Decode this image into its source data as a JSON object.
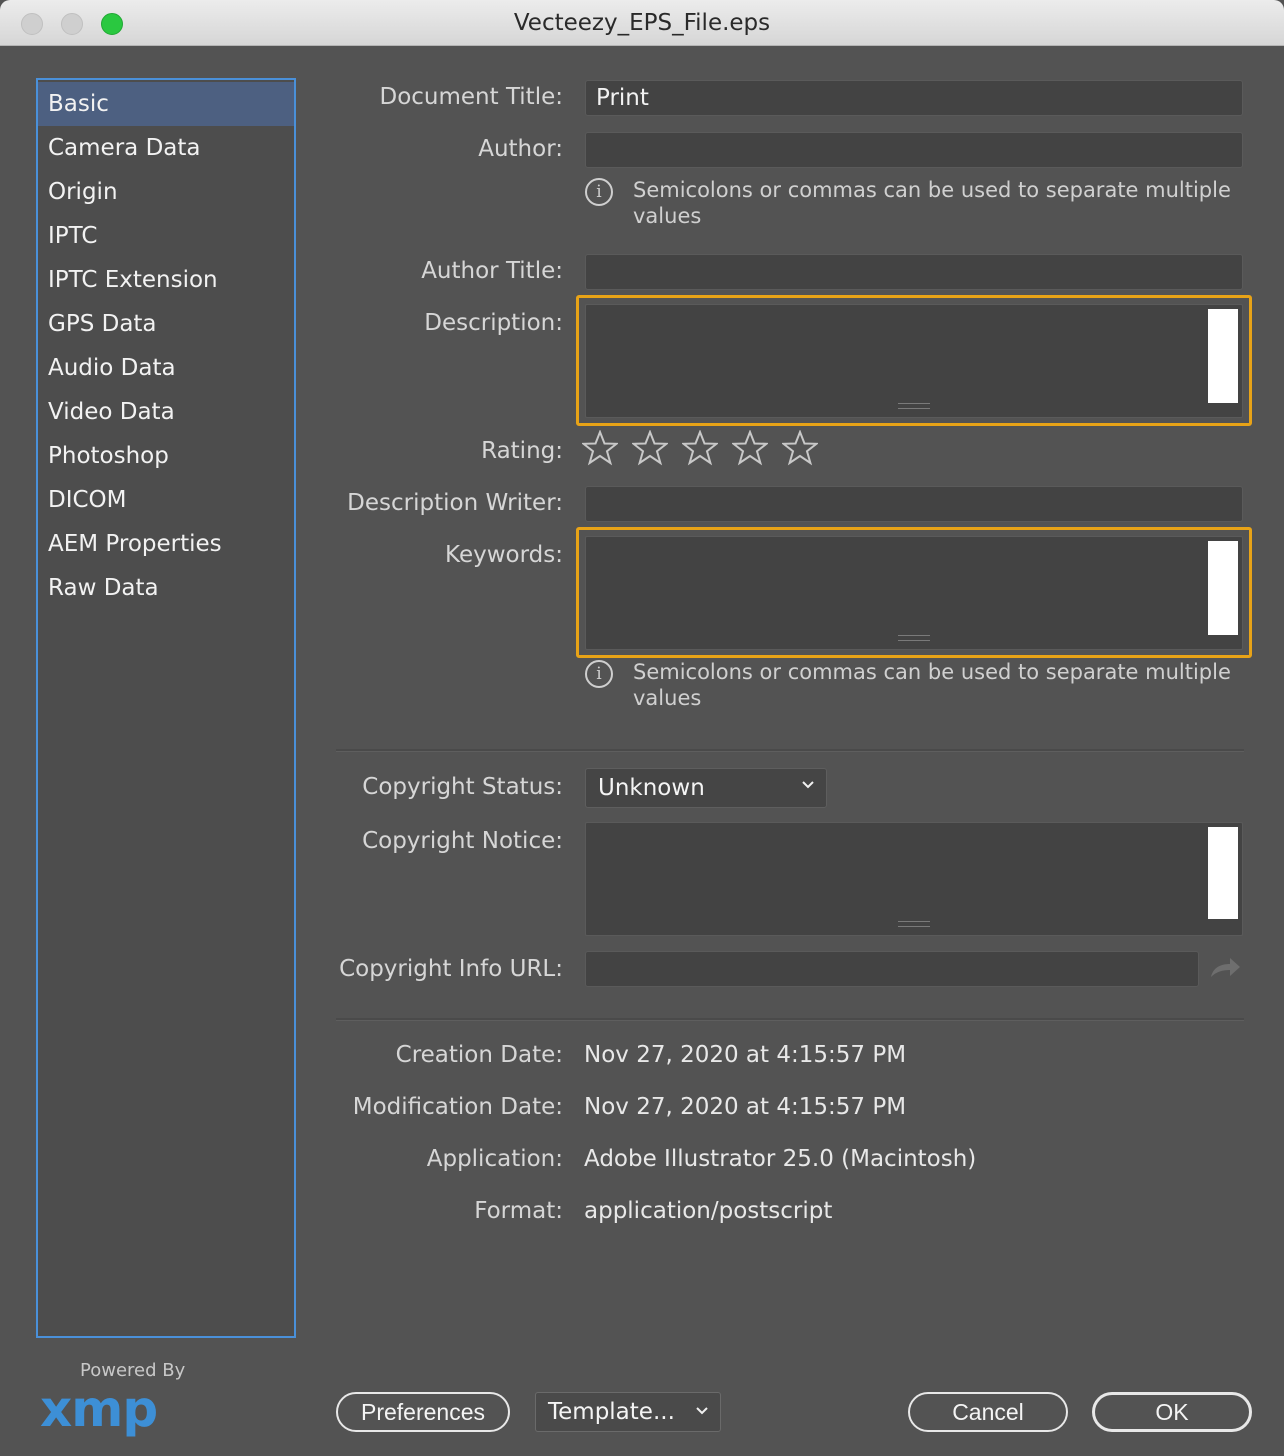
{
  "window": {
    "title": "Vecteezy_EPS_File.eps"
  },
  "sidebar": {
    "items": [
      {
        "label": "Basic",
        "active": true
      },
      {
        "label": "Camera Data"
      },
      {
        "label": "Origin"
      },
      {
        "label": "IPTC"
      },
      {
        "label": "IPTC Extension"
      },
      {
        "label": "GPS Data"
      },
      {
        "label": "Audio Data"
      },
      {
        "label": "Video Data"
      },
      {
        "label": "Photoshop"
      },
      {
        "label": "DICOM"
      },
      {
        "label": "AEM Properties"
      },
      {
        "label": "Raw Data"
      }
    ]
  },
  "branding": {
    "powered_by": "Powered By",
    "logo_text": "xmp"
  },
  "form": {
    "document_title": {
      "label": "Document Title:",
      "value": "Print"
    },
    "author": {
      "label": "Author:",
      "value": ""
    },
    "author_hint": "Semicolons or commas can be used to separate multiple values",
    "author_title": {
      "label": "Author Title:",
      "value": ""
    },
    "description": {
      "label": "Description:",
      "value": ""
    },
    "rating": {
      "label": "Rating:",
      "value": 0,
      "max": 5
    },
    "description_writer": {
      "label": "Description Writer:",
      "value": ""
    },
    "keywords": {
      "label": "Keywords:",
      "value": ""
    },
    "keywords_hint": "Semicolons or commas can be used to separate multiple values",
    "copyright_status": {
      "label": "Copyright Status:",
      "value": "Unknown"
    },
    "copyright_notice": {
      "label": "Copyright Notice:",
      "value": ""
    },
    "copyright_url": {
      "label": "Copyright Info URL:",
      "value": ""
    },
    "creation_date": {
      "label": "Creation Date:",
      "value": "Nov 27, 2020 at 4:15:57 PM"
    },
    "modification_date": {
      "label": "Modification Date:",
      "value": "Nov 27, 2020 at 4:15:57 PM"
    },
    "application": {
      "label": "Application:",
      "value": "Adobe Illustrator 25.0 (Macintosh)"
    },
    "format": {
      "label": "Format:",
      "value": "application/postscript"
    }
  },
  "buttons": {
    "preferences": "Preferences",
    "template": "Template...",
    "cancel": "Cancel",
    "ok": "OK"
  },
  "colors": {
    "accent_focus": "#e8a317",
    "sidebar_selection": "#4d6081",
    "sidebar_border": "#4a90d9",
    "xmp_blue": "#3d8fd6"
  }
}
